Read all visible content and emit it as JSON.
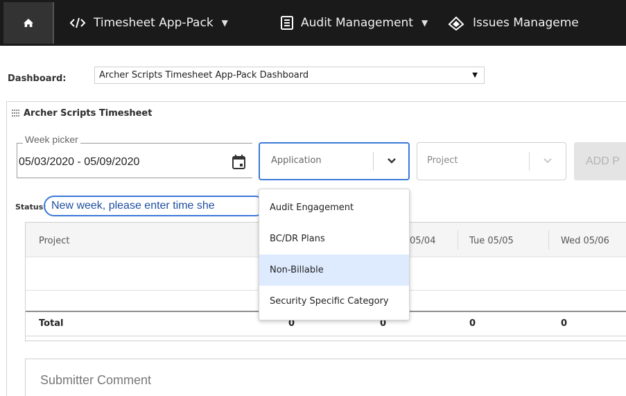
{
  "topbar": {
    "items": [
      {
        "label": "Timesheet App-Pack"
      },
      {
        "label": "Audit Management"
      },
      {
        "label": "Issues Manageme"
      }
    ]
  },
  "dashboard": {
    "label": "Dashboard:",
    "selected": "Archer Scripts Timesheet App-Pack Dashboard"
  },
  "panel": {
    "title": "Archer Scripts Timesheet"
  },
  "week_picker": {
    "legend": "Week picker",
    "value": "05/03/2020 - 05/09/2020"
  },
  "application_select": {
    "placeholder": "Application"
  },
  "project_select": {
    "placeholder": "Project"
  },
  "add_button": {
    "label": "ADD P"
  },
  "status": {
    "label": "Status:",
    "value": "New week, please enter time she"
  },
  "table": {
    "headers": [
      "Project",
      "05/04",
      "Tue 05/05",
      "Wed 05/06"
    ],
    "total_label": "Total",
    "totals": [
      "0",
      "0",
      "0",
      "0"
    ]
  },
  "dropdown": {
    "options": [
      "Audit Engagement",
      "BC/DR Plans",
      "Non-Billable",
      "Security Specific Category"
    ],
    "hovered_index": 2
  },
  "comment": {
    "placeholder": "Submitter Comment"
  },
  "colors": {
    "accent": "#3a78d8",
    "topbar": "#1a1a1a",
    "hover": "#deebff"
  }
}
